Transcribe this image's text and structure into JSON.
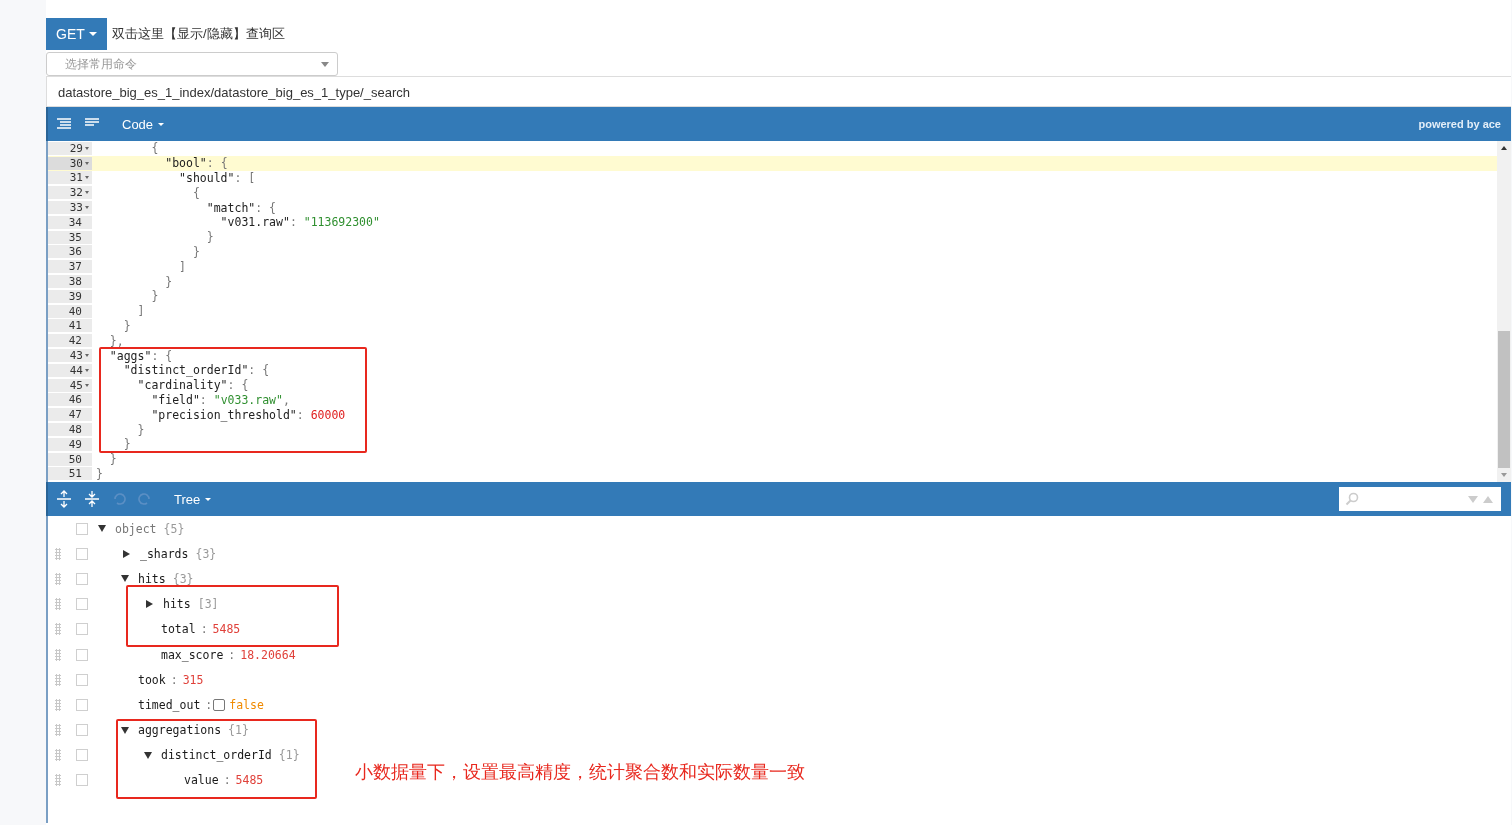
{
  "request": {
    "method": "GET",
    "hint": "双击这里【显示/隐藏】查询区",
    "command_select": {
      "placeholder": "选择常用命令"
    },
    "url": "datastore_big_es_1_index/datastore_big_es_1_type/_search"
  },
  "editor": {
    "mode": "Code",
    "credit": "powered by ace",
    "lines": [
      {
        "num": "29",
        "fold": true,
        "active": false,
        "tokens": [
          {
            "kind": "punct",
            "text": "        {"
          }
        ]
      },
      {
        "num": "30",
        "fold": true,
        "active": true,
        "tokens": [
          {
            "kind": "key",
            "text": "          \"bool\""
          },
          {
            "kind": "punct",
            "text": ": {"
          }
        ]
      },
      {
        "num": "31",
        "fold": true,
        "active": false,
        "tokens": [
          {
            "kind": "key",
            "text": "            \"should\""
          },
          {
            "kind": "punct",
            "text": ": ["
          }
        ]
      },
      {
        "num": "32",
        "fold": true,
        "active": false,
        "tokens": [
          {
            "kind": "punct",
            "text": "              {"
          }
        ]
      },
      {
        "num": "33",
        "fold": true,
        "active": false,
        "tokens": [
          {
            "kind": "key",
            "text": "                \"match\""
          },
          {
            "kind": "punct",
            "text": ": {"
          }
        ]
      },
      {
        "num": "34",
        "fold": false,
        "active": false,
        "tokens": [
          {
            "kind": "key",
            "text": "                  \"v031.raw\""
          },
          {
            "kind": "punct",
            "text": ": "
          },
          {
            "kind": "str",
            "text": "\"113692300\""
          }
        ]
      },
      {
        "num": "35",
        "fold": false,
        "active": false,
        "tokens": [
          {
            "kind": "punct",
            "text": "                }"
          }
        ]
      },
      {
        "num": "36",
        "fold": false,
        "active": false,
        "tokens": [
          {
            "kind": "punct",
            "text": "              }"
          }
        ]
      },
      {
        "num": "37",
        "fold": false,
        "active": false,
        "tokens": [
          {
            "kind": "punct",
            "text": "            ]"
          }
        ]
      },
      {
        "num": "38",
        "fold": false,
        "active": false,
        "tokens": [
          {
            "kind": "punct",
            "text": "          }"
          }
        ]
      },
      {
        "num": "39",
        "fold": false,
        "active": false,
        "tokens": [
          {
            "kind": "punct",
            "text": "        }"
          }
        ]
      },
      {
        "num": "40",
        "fold": false,
        "active": false,
        "tokens": [
          {
            "kind": "punct",
            "text": "      ]"
          }
        ]
      },
      {
        "num": "41",
        "fold": false,
        "active": false,
        "tokens": [
          {
            "kind": "punct",
            "text": "    }"
          }
        ]
      },
      {
        "num": "42",
        "fold": false,
        "active": false,
        "tokens": [
          {
            "kind": "punct",
            "text": "  },"
          }
        ]
      },
      {
        "num": "43",
        "fold": true,
        "active": false,
        "tokens": [
          {
            "kind": "key",
            "text": "  \"aggs\""
          },
          {
            "kind": "punct",
            "text": ": {"
          }
        ]
      },
      {
        "num": "44",
        "fold": true,
        "active": false,
        "tokens": [
          {
            "kind": "key",
            "text": "    \"distinct_orderId\""
          },
          {
            "kind": "punct",
            "text": ": {"
          }
        ]
      },
      {
        "num": "45",
        "fold": true,
        "active": false,
        "tokens": [
          {
            "kind": "key",
            "text": "      \"cardinality\""
          },
          {
            "kind": "punct",
            "text": ": {"
          }
        ]
      },
      {
        "num": "46",
        "fold": false,
        "active": false,
        "tokens": [
          {
            "kind": "key",
            "text": "        \"field\""
          },
          {
            "kind": "punct",
            "text": ": "
          },
          {
            "kind": "str",
            "text": "\"v033.raw\""
          },
          {
            "kind": "punct",
            "text": ","
          }
        ]
      },
      {
        "num": "47",
        "fold": false,
        "active": false,
        "tokens": [
          {
            "kind": "key",
            "text": "        \"precision_threshold\""
          },
          {
            "kind": "punct",
            "text": ": "
          },
          {
            "kind": "num",
            "text": "60000"
          }
        ]
      },
      {
        "num": "48",
        "fold": false,
        "active": false,
        "tokens": [
          {
            "kind": "punct",
            "text": "      }"
          }
        ]
      },
      {
        "num": "49",
        "fold": false,
        "active": false,
        "tokens": [
          {
            "kind": "punct",
            "text": "    }"
          }
        ]
      },
      {
        "num": "50",
        "fold": false,
        "active": false,
        "tokens": [
          {
            "kind": "punct",
            "text": "  }"
          }
        ]
      },
      {
        "num": "51",
        "fold": false,
        "active": false,
        "tokens": [
          {
            "kind": "punct",
            "text": "}"
          }
        ]
      }
    ]
  },
  "result": {
    "mode": "Tree",
    "nodes": [
      {
        "key": "object",
        "count": "{5}",
        "expanded": true,
        "children": [
          {
            "key": "_shards",
            "count": "{3}",
            "expanded": false
          },
          {
            "key": "hits",
            "count": "{3}",
            "expanded": true,
            "children": [
              {
                "key": "hits",
                "count": "[3]",
                "expanded": false
              },
              {
                "key": "total",
                "sep": ":",
                "kind": "number",
                "value": "5485"
              },
              {
                "key": "max_score",
                "sep": ":",
                "kind": "number",
                "value": "18.20664"
              }
            ]
          },
          {
            "key": "took",
            "sep": ":",
            "kind": "number",
            "value": "315"
          },
          {
            "key": "timed_out",
            "sep": ":",
            "kind": "boolean",
            "checked": false,
            "value": "false"
          },
          {
            "key": "aggregations",
            "count": "{1}",
            "expanded": true,
            "children": [
              {
                "key": "distinct_orderId",
                "count": "{1}",
                "expanded": true,
                "children": [
                  {
                    "key": "value",
                    "sep": ":",
                    "kind": "number",
                    "value": "5485"
                  }
                ]
              }
            ]
          }
        ]
      }
    ]
  },
  "annotation": "小数据量下，设置最高精度，统计聚合数和实际数量一致"
}
